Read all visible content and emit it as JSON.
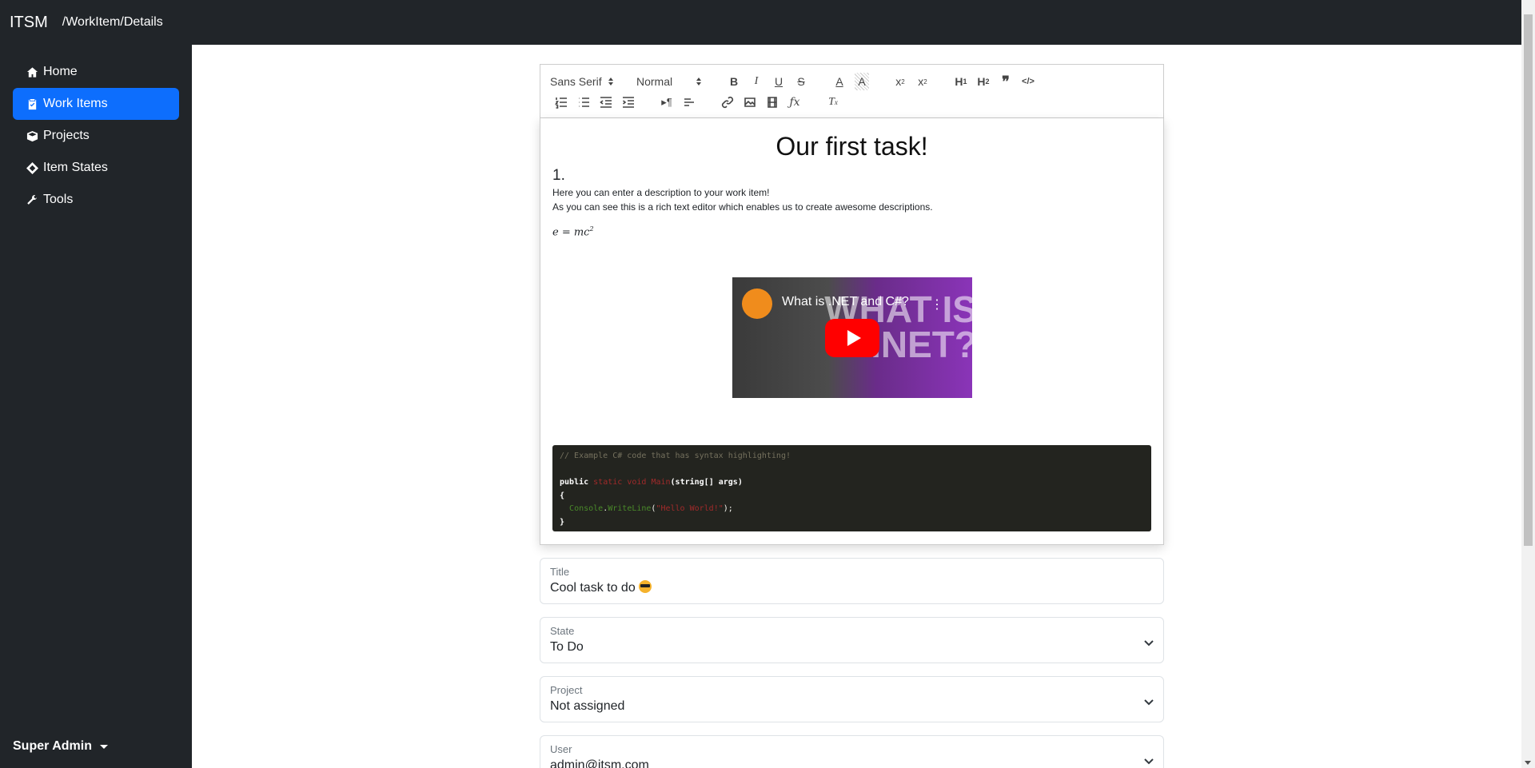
{
  "header": {
    "brand": "ITSM",
    "path": "/WorkItem/Details"
  },
  "sidebar": {
    "items": [
      {
        "label": "Home",
        "icon": "home-icon",
        "active": false
      },
      {
        "label": "Work Items",
        "icon": "clipboard-icon",
        "active": true
      },
      {
        "label": "Projects",
        "icon": "box-icon",
        "active": false
      },
      {
        "label": "Item States",
        "icon": "diamond-icon",
        "active": false
      },
      {
        "label": "Tools",
        "icon": "wrench-icon",
        "active": false
      }
    ],
    "user": "Super Admin"
  },
  "editor": {
    "toolbar": {
      "font": "Sans Serif",
      "size": "Normal"
    },
    "heading": "Our first task!",
    "list_number": "1.",
    "desc_line1": "Here you can enter a description to your work item!",
    "desc_line2": "As you can see this is a rich text editor which enables us to create awesome descriptions.",
    "math": "e = mc",
    "math_exp": "2",
    "video": {
      "title": "What is .NET and C#?",
      "overlay_l1": "WHAT IS",
      "overlay_l2": ".NET?"
    },
    "code": {
      "comment": "// Example C# code that has syntax highlighting!",
      "kw_public": "public",
      "kw_static": "static",
      "kw_void": "void",
      "method": "Main",
      "params": "(string[] args)",
      "open_brace": "{",
      "console": "Console",
      "dot": ".",
      "writeline": "WriteLine",
      "paren_open": "(",
      "string": "\"Hello World!\"",
      "paren_close": ");",
      "close_brace": "}"
    }
  },
  "form": {
    "title": {
      "label": "Title",
      "value": "Cool task to do"
    },
    "state": {
      "label": "State",
      "value": "To Do"
    },
    "project": {
      "label": "Project",
      "value": "Not assigned"
    },
    "user": {
      "label": "User",
      "value": "admin@itsm.com"
    }
  },
  "colors": {
    "navbar": "#212529",
    "active": "#0d6efd",
    "code_bg": "#23241f"
  }
}
